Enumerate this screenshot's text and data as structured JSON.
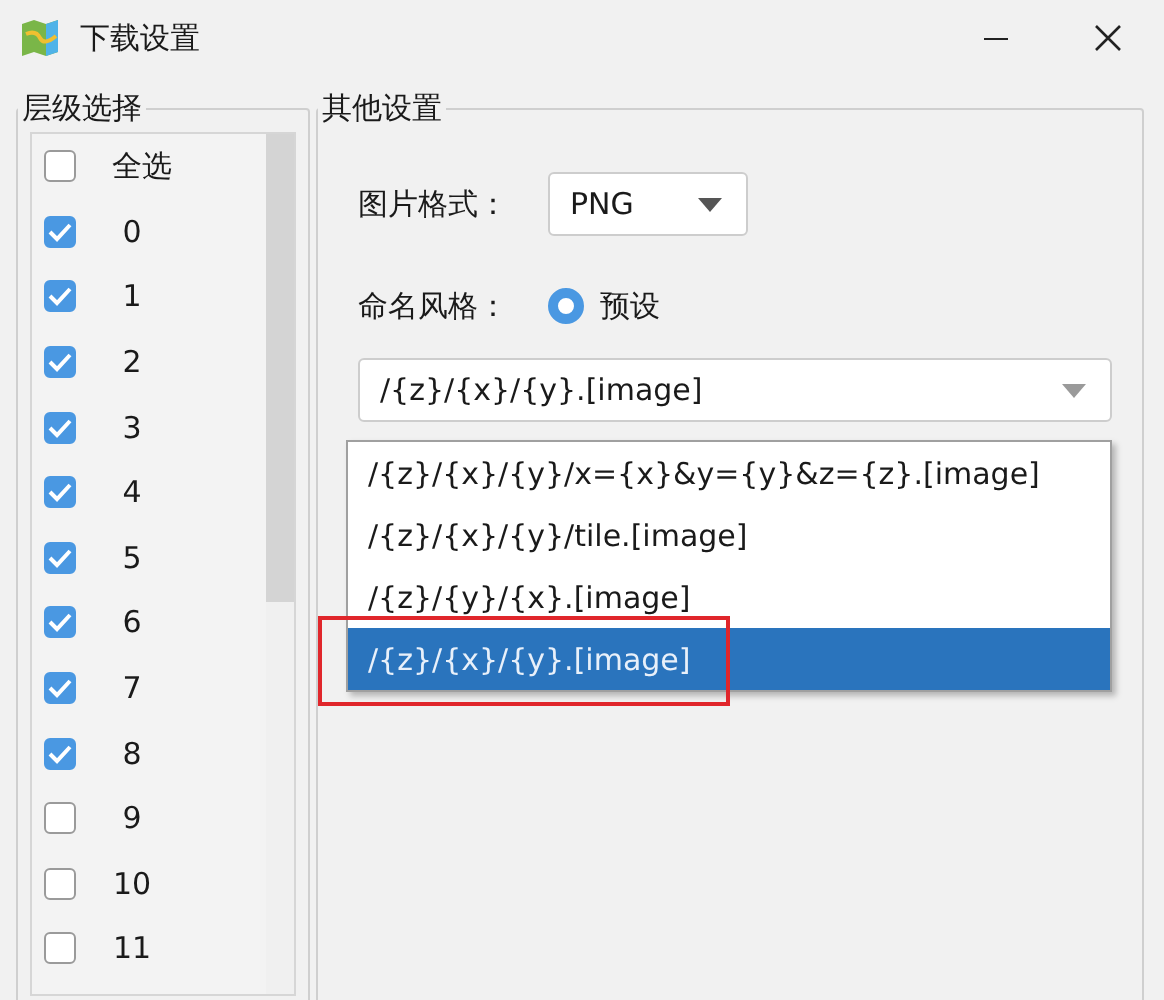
{
  "window": {
    "title": "下载设置"
  },
  "level_group": {
    "title": "层级选择",
    "items": [
      {
        "label": "全选",
        "checked": false
      },
      {
        "label": "0",
        "checked": true
      },
      {
        "label": "1",
        "checked": true
      },
      {
        "label": "2",
        "checked": true
      },
      {
        "label": "3",
        "checked": true
      },
      {
        "label": "4",
        "checked": true
      },
      {
        "label": "5",
        "checked": true
      },
      {
        "label": "6",
        "checked": true
      },
      {
        "label": "7",
        "checked": true
      },
      {
        "label": "8",
        "checked": true
      },
      {
        "label": "9",
        "checked": false
      },
      {
        "label": "10",
        "checked": false
      },
      {
        "label": "11",
        "checked": false
      }
    ]
  },
  "other_group": {
    "title": "其他设置",
    "format": {
      "label": "图片格式：",
      "value": "PNG"
    },
    "naming": {
      "label": "命名风格：",
      "option": {
        "label": "预设",
        "selected": true
      }
    },
    "template_combo": {
      "value": "/{z}/{x}/{y}.[image]",
      "options": [
        {
          "label": "/{z}/{x}/{y}/x={x}&y={y}&z={z}.[image]",
          "selected": false
        },
        {
          "label": "/{z}/{x}/{y}/tile.[image]",
          "selected": false
        },
        {
          "label": "/{z}/{y}/{x}.[image]",
          "selected": false
        },
        {
          "label": "/{z}/{x}/{y}.[image]",
          "selected": true
        }
      ]
    }
  }
}
